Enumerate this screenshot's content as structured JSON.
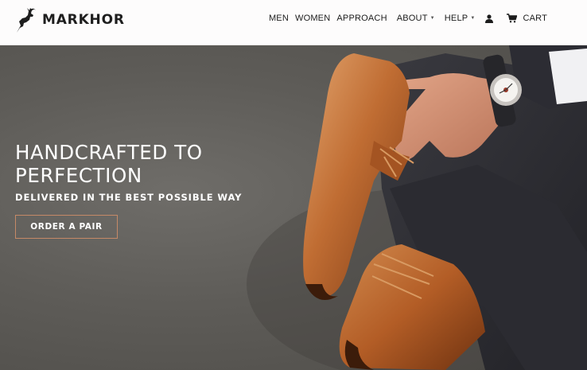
{
  "brand": {
    "name": "MARKHOR",
    "logo_icon": "markhor-goat-icon"
  },
  "nav": {
    "items": [
      {
        "label": "MEN",
        "dropdown": false
      },
      {
        "label": "WOMEN",
        "dropdown": false
      },
      {
        "label": "APPROACH",
        "dropdown": false
      },
      {
        "label": "ABOUT",
        "dropdown": true
      },
      {
        "label": "HELP",
        "dropdown": true
      }
    ],
    "caret_glyph": "▼",
    "account_icon": "user-icon",
    "cart_icon": "cart-icon",
    "cart_label": "CART"
  },
  "hero": {
    "headline": "HANDCRAFTED TO PERFECTION",
    "subheadline": "DELIVERED IN THE BEST POSSIBLE WAY",
    "cta_label": "ORDER A PAIR",
    "background_image": "man-seated-in-tan-leather-oxford-shoes-and-wristwatch"
  },
  "colors": {
    "header_bg": "#fdfcfc",
    "text_dark": "#1c1c1c",
    "cta_border": "#c58967",
    "leather": "#b8612a",
    "felt_grey": "#65635f"
  }
}
